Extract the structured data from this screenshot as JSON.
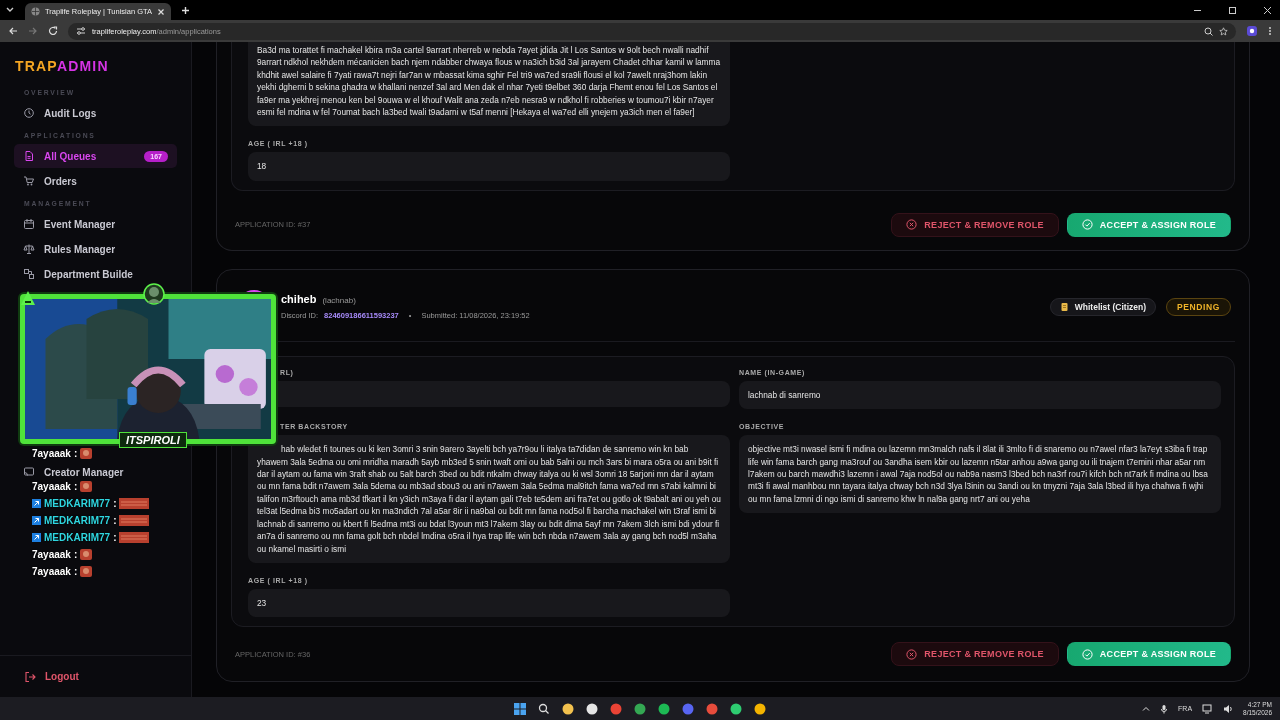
{
  "browser": {
    "tab_title": "Traplife Roleplay | Tunisian GTA",
    "url_host": "trapliferoleplay.com",
    "url_path": "/admin/applications"
  },
  "sidebar": {
    "logo_left": "TRAP",
    "logo_right": "ADMIN",
    "sections": [
      {
        "title": "OVERVIEW",
        "items": [
          {
            "label": "Audit Logs",
            "selected": false
          }
        ]
      },
      {
        "title": "APPLICATIONS",
        "items": [
          {
            "label": "All Queues",
            "selected": true,
            "badge": "167"
          },
          {
            "label": "Orders",
            "selected": false
          }
        ]
      },
      {
        "title": "MANAGEMENT",
        "items": [
          {
            "label": "Event Manager",
            "selected": false
          },
          {
            "label": "Rules Manager",
            "selected": false
          },
          {
            "label": "Department Builde",
            "selected": false
          },
          {
            "label": "Creator Manager",
            "selected": false
          }
        ]
      }
    ],
    "logout": "Logout"
  },
  "cards": [
    {
      "rows": [
        [
          {
            "value": "Ba3d ma torattet fi machakel kbira m3a cartel 9arrart nherreb w nebda 7ayet jdida Jit l Los Santos w 9olt bech nwalli nadhif 9arrart ndkhol nekhdem mécanicien bach njem ndabber chwaya flous w na3ich b3id 3al jarayem Chadet chhar kamil w lamma khdhit awel salaire fi 7yati rawa7t nejri far7an w mbassat kima sghir Fel tri9 wa7ed sra9li flousi el kol 7awelt nraj3hom lakin yekhi dgherni b sekina ghadra w khallani nenzef 3al ard Men dak el nhar 7yeti t9elbet 360 darja Fhemt enou fel Los Santos el fa9er ma yekhrej menou ken bel 9ouwa w el khouf Walit ana zeda n7eb nesra9 w ndkhol fi robberies w toumou7i kbir n7ayer esmi fel mdina w fel 7oumat bach la3bed twali t9adarni w t5af menni [Hekaya el wa7ed elli ynejem ya3ich men el fa9er]"
          }
        ],
        [
          {
            "label": "AGE ( IRL +18 )",
            "value": "18"
          }
        ]
      ],
      "app_id": "APPLICATION ID: #37",
      "reject": "REJECT & REMOVE ROLE",
      "accept": "ACCEPT & ASSIGN ROLE"
    },
    {
      "header": {
        "name": "chiheb",
        "username": "(lachnab)",
        "discord_label": "Discord ID:",
        "discord_id": "824609186611593237",
        "separator": "•",
        "submitted": "Submitted: 11/08/2026, 23:19:52",
        "tag": "Whitelist (Citizen)",
        "status": "PENDING"
      },
      "rows": [
        [
          {
            "label": "RL)"
          },
          {
            "label": "NAME (IN-GAME)",
            "value": "lachnab di sanremo"
          }
        ],
        [
          {
            "label": "TER BACKSTORY",
            "value": "hab wledet fi tounes ou ki ken 3omri 3 snin 9arero 3ayelti bch ya7r9ou li italya ta7didan de sanremo win kn bab yhawem 3ala 5edma ou omi mridha maradh 5ayb mb3ed 5 snin twaft omi ou bab 5alni ou mch 3ars bi mara o5ra ou ani b9it fi dar il aytam ou fama win 3raft shab ou 5alt barch 3bed ou bdit ntkalm chway italya ou ki wsl 3omri 18 5arjoni mn dar il aytam ou mn fama bdit n7awem 3ala 5dema ou mb3ad sbou3 ou ani n7awem 3ala 5edma mal9itch fama wa7ed mn s7abi kalmni bi talifon m3rftouch ama mb3d tfkart il kn y3ich m3aya fi dar il aytam gali t7eb te5dem ani fra7et ou gotlo ok t9abalt ani ou yeh ou tel3at l5edma bi3 mo5adart ou kn ma3ndich 7al a5ar 8ir ii na9bal ou bdit mn fama nod5ol fi barcha machakel win t3raf ismi bi lachnab di sanremo ou kbert fi l5edma mt3i ou bdat l3youn mt3 l7akem 3lay ou bdit dima 5ayf mn 7akem 3lch ismi bdi ydour fi an7a di sanremo ou mn fama golt bch nbdel lmdina o5ra il hya trap life win bch nbda n7awem 3ala ay gang bch nod5l m3aha ou nkamel masirti o ismi"
          },
          {
            "label": "OBJECTIVE",
            "value": "objective mt3i nwasel ismi fi mdina ou lazemn mn3malch nafs il 8lat ili 3mlto fi di snaremo ou n7awel nfar3 la7eyt s3iba fi trap life win fama barch gang ma3rouf ou 3andha isem kbir ou lazemn n5tar anhou a9wa gang ou ili tnajem t7emini nhar a5ar nm l7akem ou barch mawdhi3 lazemn i awal 7aja nod5ol ou nab9a nasm3 l3bed bch na3rf rou7i kifch bch nt7ark fi mdina ou lbsa mt3i fi awal manhbou mn tayara italya chway bch n3d 3lya l3inin ou 3andi ou kn tmyzni 7aja 3ala l3bed ili hya chahwa fi wjhi ou mn fama lzmni di ngo ismi di sanremo khw ln nal9a gang nrt7 ani ou yeha"
          }
        ],
        [
          {
            "label": "AGE ( IRL +18 )",
            "value": "23"
          }
        ]
      ],
      "app_id": "APPLICATION ID: #36",
      "reject": "REJECT & REMOVE ROLE",
      "accept": "ACCEPT & ASSIGN ROLE"
    }
  ],
  "stream_overlay": {
    "streamer": "ITSPIROLI",
    "chat": [
      {
        "user": "7ayaaak",
        "sep": ":",
        "kind": "plain"
      },
      {
        "user": "7ayaaak",
        "sep": ":",
        "kind": "plain"
      },
      {
        "user": "MEDKARIM77",
        "sep": ":",
        "kind": "badge"
      },
      {
        "user": "MEDKARIM77",
        "sep": ":",
        "kind": "badge"
      },
      {
        "user": "MEDKARIM77",
        "sep": ":",
        "kind": "badge"
      },
      {
        "user": "7ayaaak",
        "sep": ":",
        "kind": "plain"
      },
      {
        "user": "7ayaaak",
        "sep": ":",
        "kind": "plain"
      }
    ]
  },
  "taskbar": {
    "language": "FRA",
    "time": "4:27 PM",
    "date": "8/15/2026"
  }
}
